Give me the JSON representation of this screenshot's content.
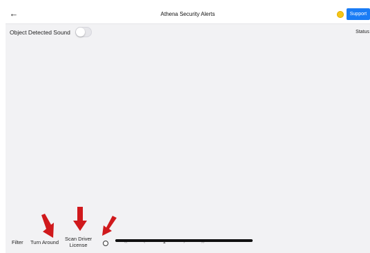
{
  "header": {
    "back_icon": "arrow-left-icon",
    "title": "Athena Security Alerts",
    "status_dot_color": "#f5c518",
    "support_label": "Support",
    "support_color": "#1a7cf5"
  },
  "toolbar": {
    "sound_label": "Object Detected Sound",
    "sound_enabled": false,
    "status_label": "Status"
  },
  "footer": {
    "filter_label": "Filter",
    "turn_around_label": "Turn Around",
    "scan_license_label_line1": "Scan Driver",
    "scan_license_label_line2": "License",
    "circle_icon": "circle-icon",
    "first_page_icon": "«",
    "prev_page_icon": "‹",
    "current_page": "1",
    "next_page_icon": "›",
    "last_page_icon": "»"
  },
  "annotations": {
    "arrow_color": "#d0191c"
  }
}
